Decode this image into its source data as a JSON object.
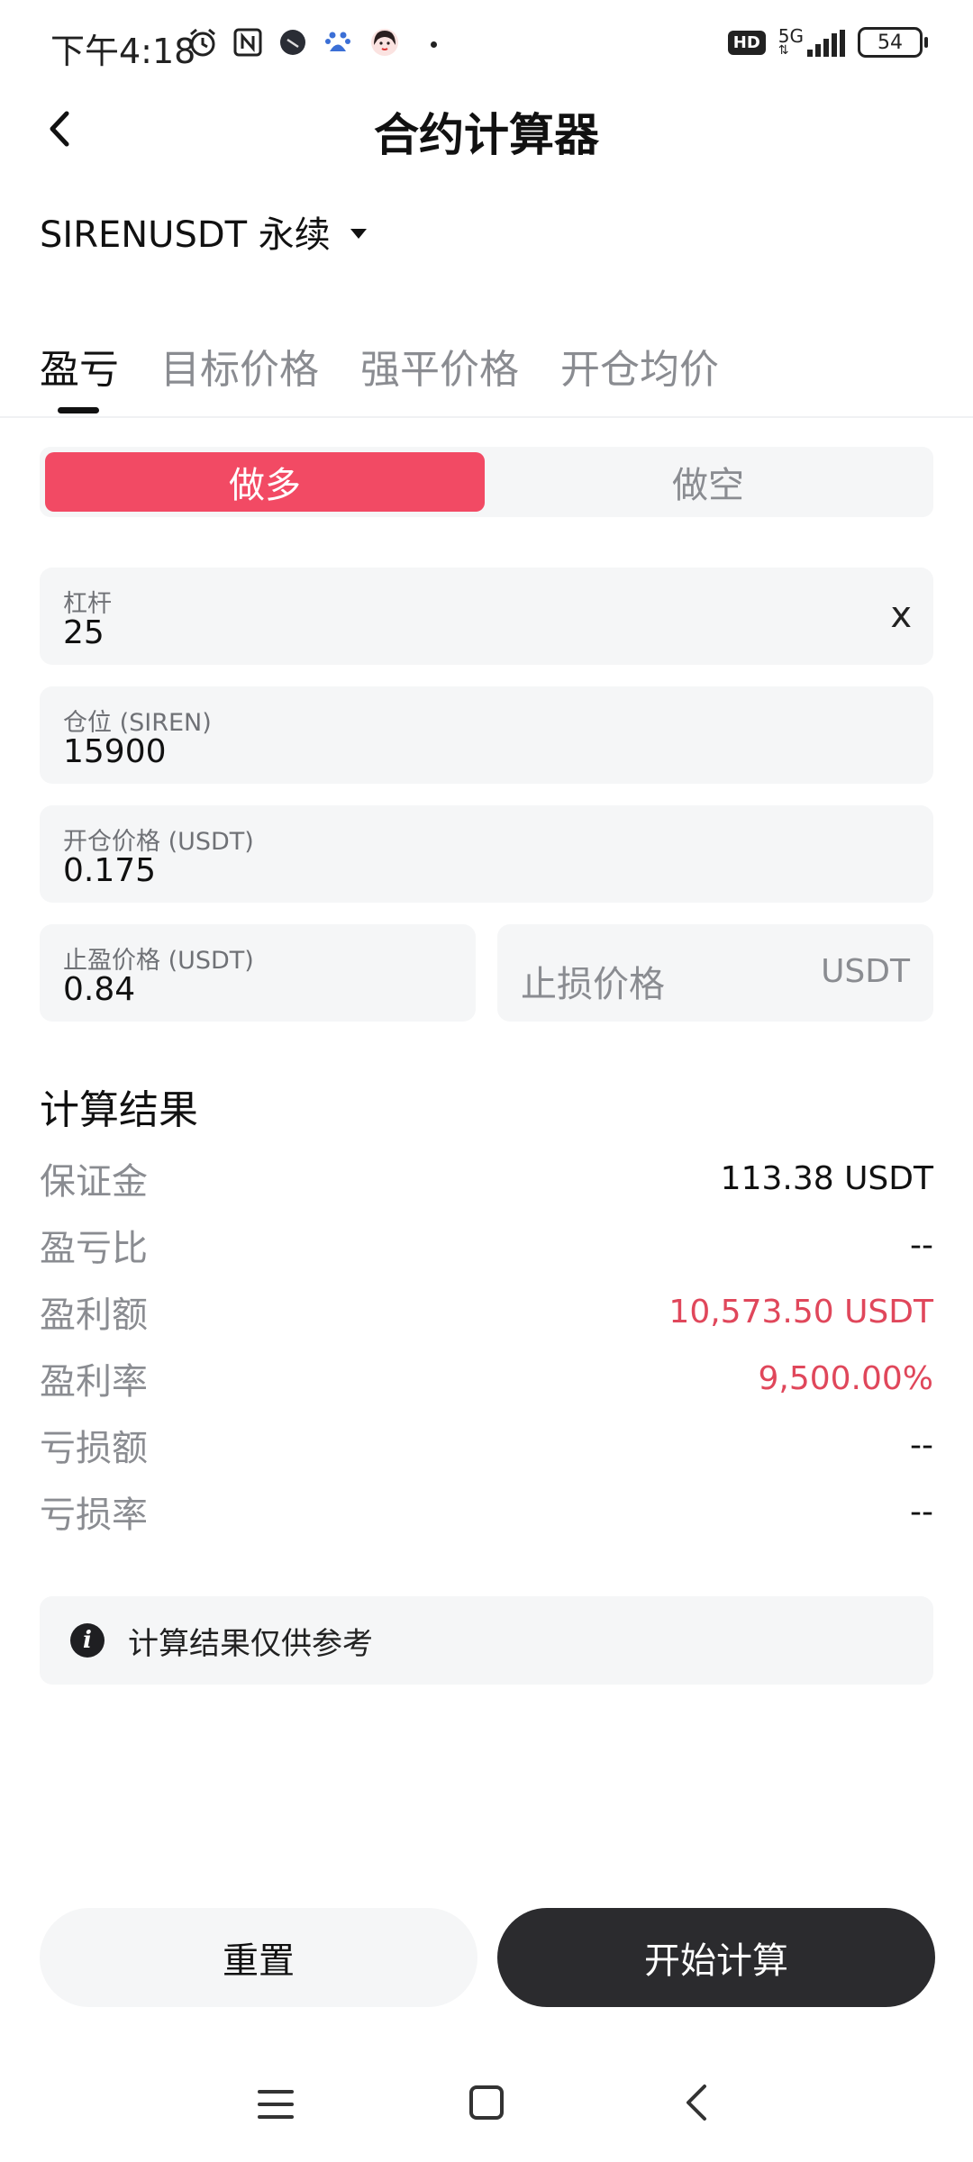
{
  "status_bar": {
    "time": "下午4:18",
    "icons": [
      "alarm-icon",
      "nfc-icon",
      "app-icon",
      "baidu-icon",
      "avatar-icon",
      "dot-icon"
    ],
    "hd": "HD",
    "network": "5G",
    "battery": "54"
  },
  "header": {
    "title": "合约计算器",
    "back_icon": "chevron-left-icon"
  },
  "symbol": {
    "name": "SIRENUSDT 永续",
    "dropdown_icon": "caret-down-icon"
  },
  "tabs": [
    {
      "label": "盈亏",
      "active": true
    },
    {
      "label": "目标价格",
      "active": false
    },
    {
      "label": "强平价格",
      "active": false
    },
    {
      "label": "开仓均价",
      "active": false
    }
  ],
  "direction": {
    "long_label": "做多",
    "short_label": "做空",
    "selected": "long"
  },
  "fields": {
    "leverage": {
      "label": "杠杆",
      "value": "25",
      "suffix": "x"
    },
    "position": {
      "label": "仓位 (SIREN)",
      "value": "15900"
    },
    "entry_price": {
      "label": "开仓价格 (USDT)",
      "value": "0.175"
    },
    "take_profit": {
      "label": "止盈价格 (USDT)",
      "value": "0.84"
    },
    "stop_loss": {
      "placeholder": "止损价格",
      "unit": "USDT"
    }
  },
  "results": {
    "title": "计算结果",
    "rows": [
      {
        "label": "保证金",
        "value": "113.38 USDT",
        "highlight": false
      },
      {
        "label": "盈亏比",
        "value": "--",
        "highlight": false
      },
      {
        "label": "盈利额",
        "value": "10,573.50 USDT",
        "highlight": true
      },
      {
        "label": "盈利率",
        "value": "9,500.00%",
        "highlight": true
      },
      {
        "label": "亏损额",
        "value": "--",
        "highlight": false
      },
      {
        "label": "亏损率",
        "value": "--",
        "highlight": false
      }
    ]
  },
  "note": {
    "icon": "info-icon",
    "text": "计算结果仅供参考"
  },
  "buttons": {
    "reset": "重置",
    "calculate": "开始计算"
  },
  "colors": {
    "accent_red": "#f24a64",
    "profit_red": "#e0475b",
    "dark_button": "#2b2b2e",
    "field_bg": "#f5f6f7"
  }
}
